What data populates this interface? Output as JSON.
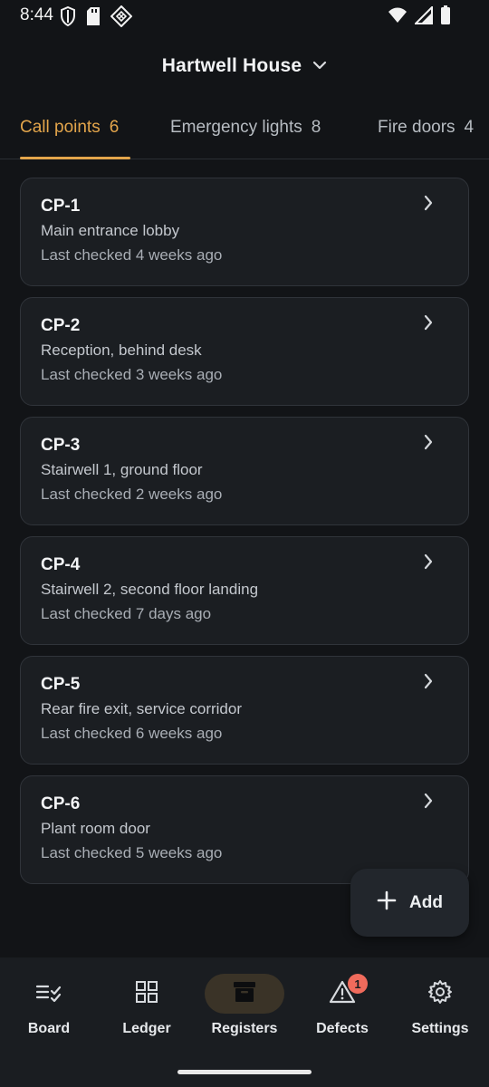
{
  "status_bar": {
    "time": "8:44"
  },
  "header": {
    "title": "Hartwell House"
  },
  "tabs": [
    {
      "label": "Call points",
      "count": "6",
      "active": true
    },
    {
      "label": "Emergency lights",
      "count": "8",
      "active": false
    },
    {
      "label": "Fire doors",
      "count": "4",
      "active": false
    }
  ],
  "items": [
    {
      "id": "CP-1",
      "location": "Main entrance lobby",
      "checked": "Last checked 4 weeks ago"
    },
    {
      "id": "CP-2",
      "location": "Reception, behind desk",
      "checked": "Last checked 3 weeks ago"
    },
    {
      "id": "CP-3",
      "location": "Stairwell 1, ground floor",
      "checked": "Last checked 2 weeks ago"
    },
    {
      "id": "CP-4",
      "location": "Stairwell 2, second floor landing",
      "checked": "Last checked 7 days ago"
    },
    {
      "id": "CP-5",
      "location": "Rear fire exit, service corridor",
      "checked": "Last checked 6 weeks ago"
    },
    {
      "id": "CP-6",
      "location": "Plant room door",
      "checked": "Last checked 5 weeks ago"
    }
  ],
  "fab": {
    "label": "Add",
    "icon": "plus-icon"
  },
  "nav": [
    {
      "label": "Board",
      "icon": "checklist-icon",
      "active": false
    },
    {
      "label": "Ledger",
      "icon": "grid-icon",
      "active": false
    },
    {
      "label": "Registers",
      "icon": "archive-box-icon",
      "active": true
    },
    {
      "label": "Defects",
      "icon": "warning-icon",
      "active": false,
      "badge": "1"
    },
    {
      "label": "Settings",
      "icon": "gear-icon",
      "active": false
    }
  ],
  "colors": {
    "accent": "#e3a54b",
    "background": "#121417",
    "card": "#1b1e22",
    "badge": "#f06b5c"
  }
}
